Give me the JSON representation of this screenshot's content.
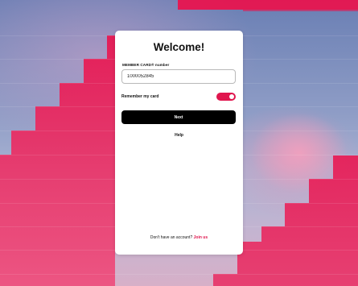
{
  "login": {
    "title": "Welcome!",
    "card_label": "MEMBER CARD® number",
    "card_value": "1000052845",
    "remember_label": "Remember my card",
    "remember_on": true,
    "next_label": "Next",
    "help_label": "Help",
    "no_account_text": "Don't have an account?",
    "join_label": "Join us"
  },
  "theme": {
    "accent": "#e0164e",
    "button_bg": "#000000",
    "card_bg": "#ffffff"
  }
}
